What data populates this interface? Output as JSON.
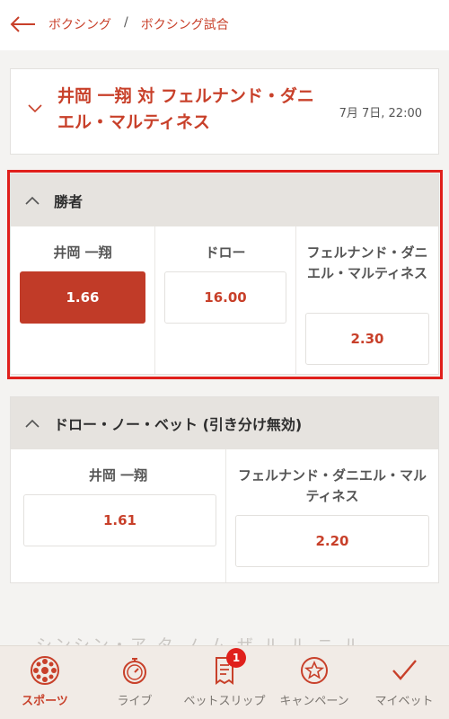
{
  "breadcrumb": {
    "item1": "ボクシング",
    "separator": "/",
    "item2": "ボクシング試合"
  },
  "match": {
    "title": "井岡 一翔 対 フェルナンド・ダニエル・マルティネス",
    "date": "7月 7日, 22:00"
  },
  "markets": [
    {
      "title": "勝者",
      "selections": [
        {
          "name": "井岡 一翔",
          "odds": "1.66",
          "selected": true
        },
        {
          "name": "ドロー",
          "odds": "16.00",
          "selected": false
        },
        {
          "name": "フェルナンド・ダニエル・マルティネス",
          "odds": "2.30",
          "selected": false
        }
      ]
    },
    {
      "title": "ドロー・ノー・ベット (引き分け無効)",
      "selections": [
        {
          "name": "井岡 一翔",
          "odds": "1.61",
          "selected": false
        },
        {
          "name": "フェルナンド・ダニエル・マルティネス",
          "odds": "2.20",
          "selected": false
        }
      ]
    }
  ],
  "faded_text": "シンシン・ア タ ノ ム ザ ル ル ニ ル",
  "bottom_nav": [
    {
      "label": "スポーツ",
      "icon": "sports-ball-icon",
      "active": true
    },
    {
      "label": "ライブ",
      "icon": "live-stopwatch-icon",
      "active": false
    },
    {
      "label": "ベットスリップ",
      "icon": "betslip-receipt-icon",
      "active": false,
      "badge": "1"
    },
    {
      "label": "キャンペーン",
      "icon": "campaign-star-icon",
      "active": false
    },
    {
      "label": "マイベット",
      "icon": "checkmark-icon",
      "active": false
    }
  ],
  "colors": {
    "accent": "#c8402a",
    "selected_odds_bg": "#c13b28",
    "highlight_border": "#e0201c",
    "market_header_bg": "#e6e3df"
  }
}
